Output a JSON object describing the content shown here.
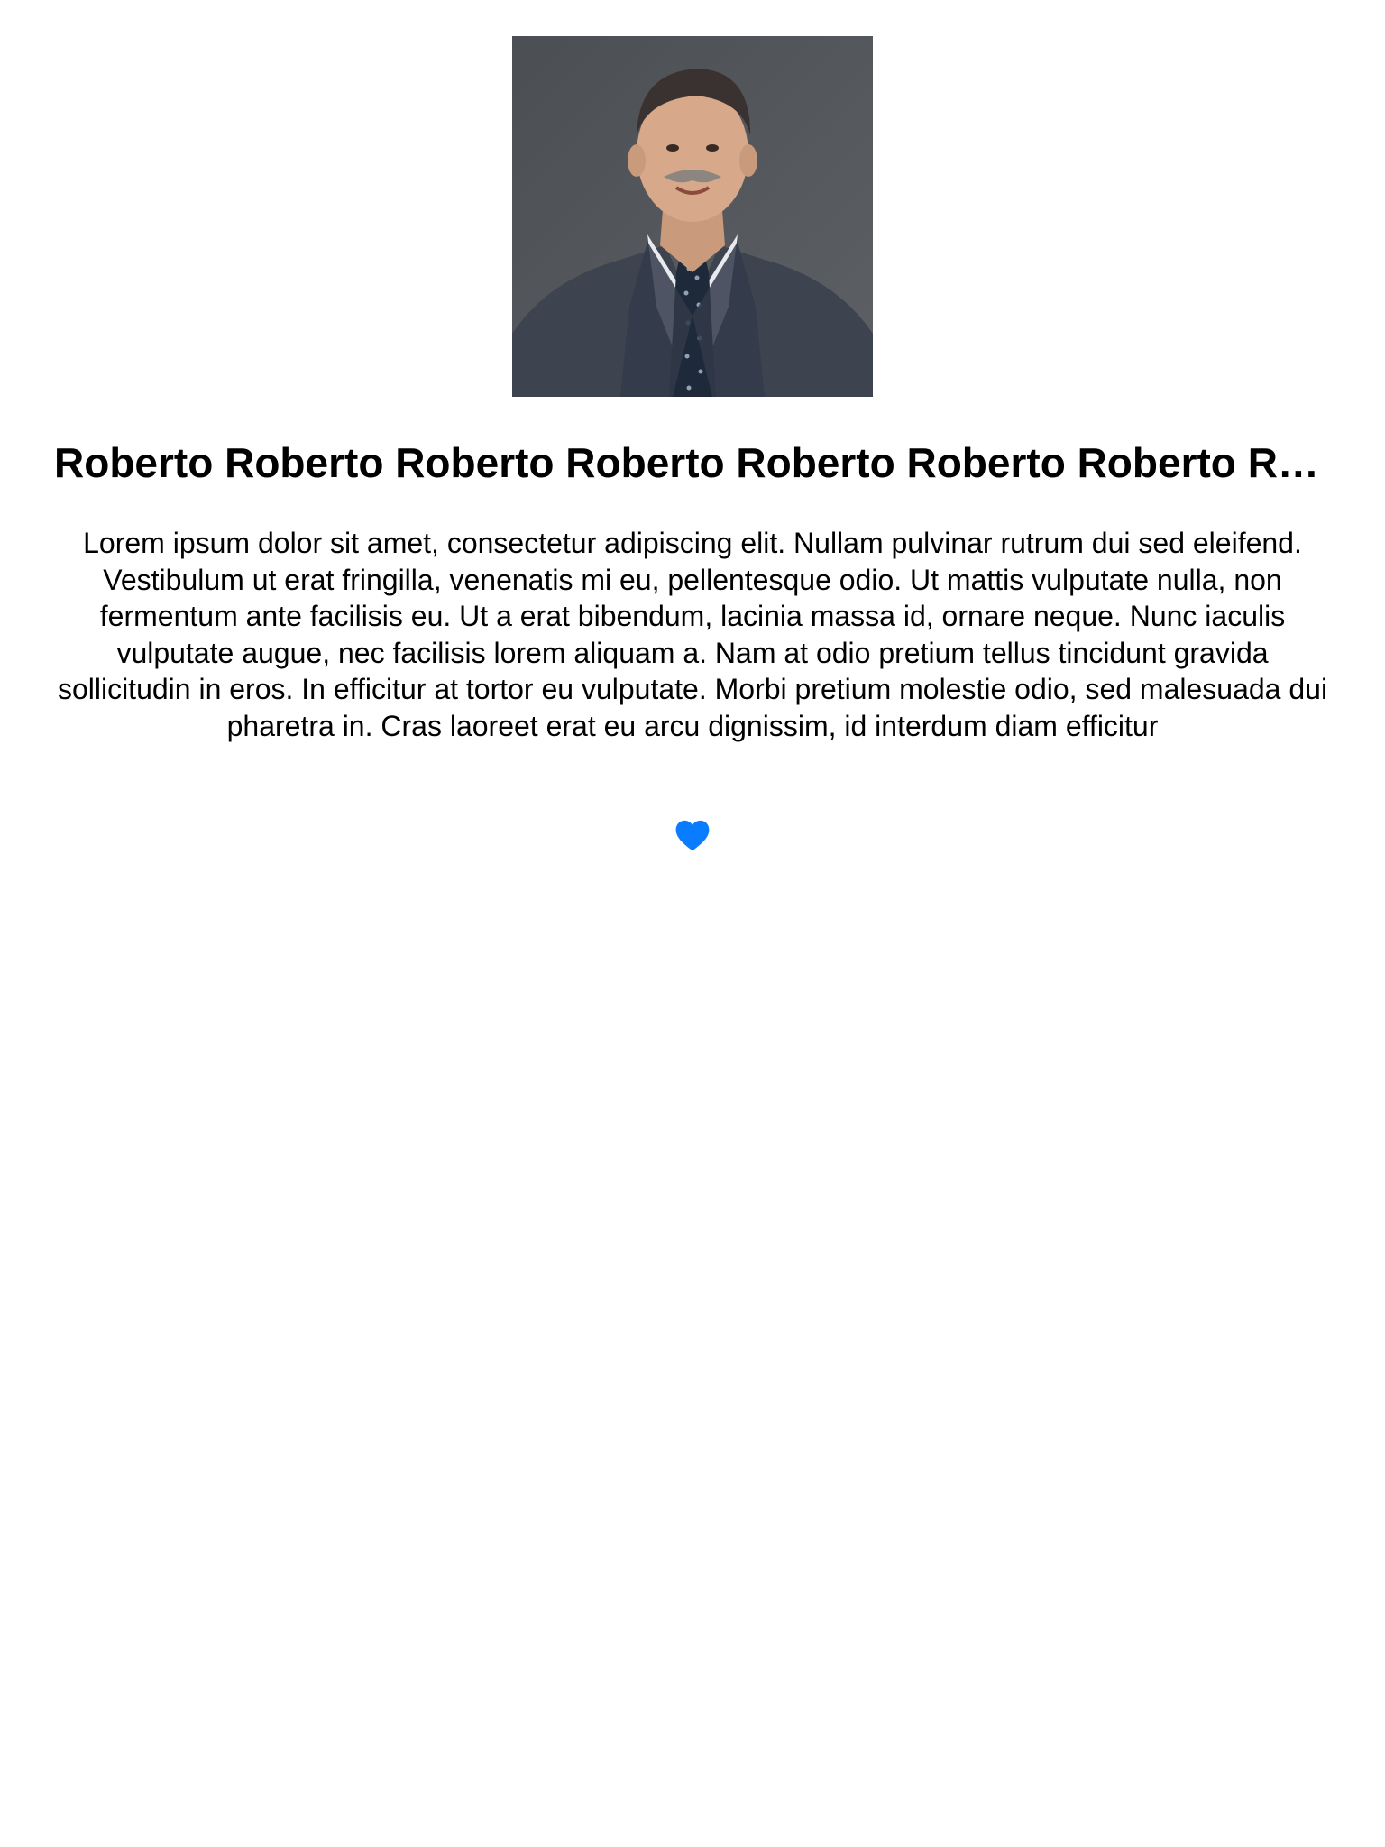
{
  "profile": {
    "photo_description_icon": "person-photo",
    "name": "Roberto Roberto Roberto Roberto Roberto Roberto Roberto Roberto Roberto",
    "bio": "Lorem ipsum dolor sit amet, consectetur adipiscing elit. Nullam pulvinar rutrum dui sed eleifend. Vestibulum ut erat fringilla, venenatis mi eu, pellentesque odio. Ut mattis vulputate nulla, non fermentum ante facilisis eu. Ut a erat bibendum, lacinia massa id, ornare neque. Nunc iaculis vulputate augue, nec facilisis lorem aliquam a. Nam at odio pretium tellus tincidunt gravida sollicitudin in eros. In efficitur at tortor eu vulputate. Morbi pretium molestie odio, sed malesuada dui pharetra in. Cras laoreet erat eu arcu dignissim, id interdum diam efficitur"
  },
  "actions": {
    "favorite_icon": "heart-icon",
    "favorite_color": "#0a7cff"
  }
}
